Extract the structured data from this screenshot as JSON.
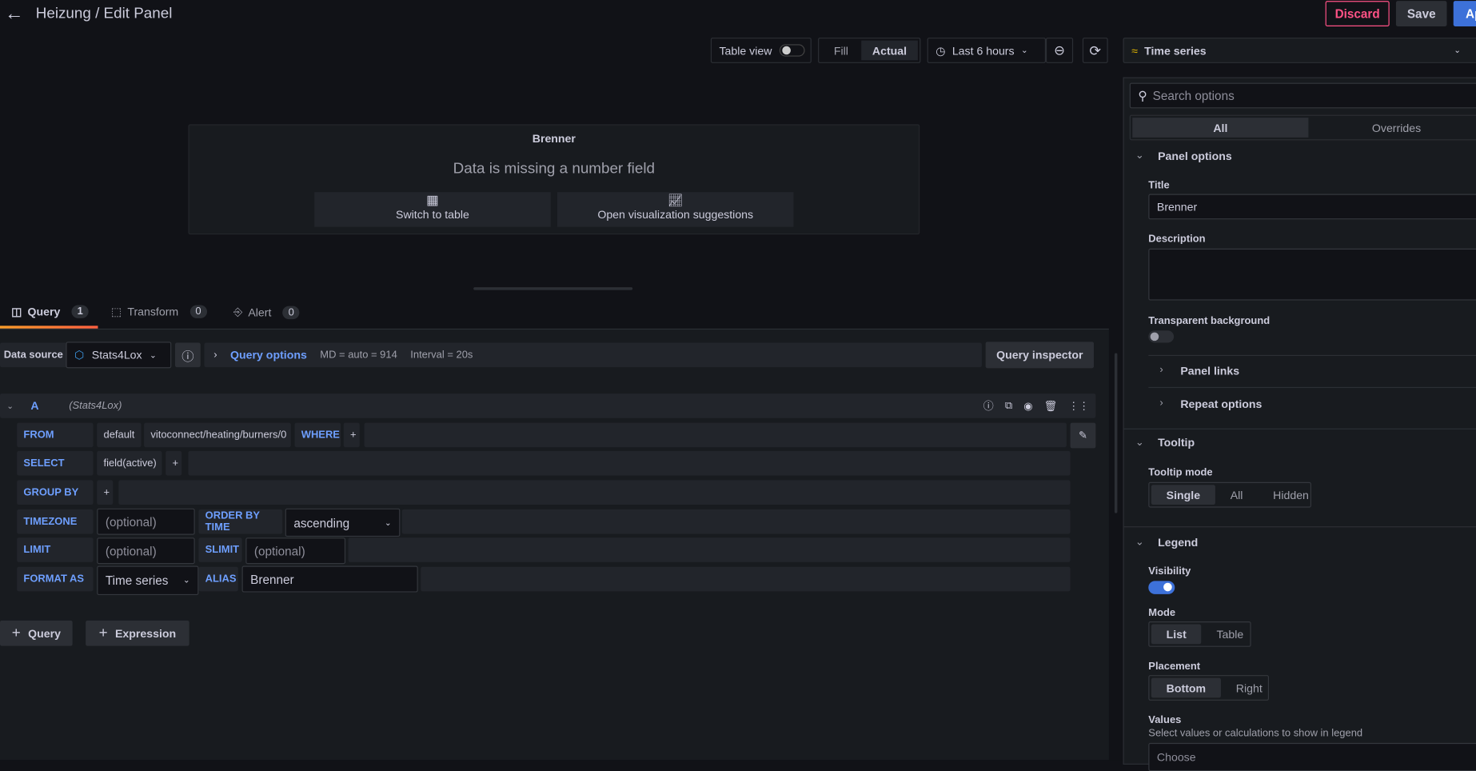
{
  "header": {
    "title": "Heizung / Edit Panel",
    "discard": "Discard",
    "save": "Save",
    "apply": "Apply"
  },
  "toolbar": {
    "table_view": "Table view",
    "fill": "Fill",
    "actual": "Actual",
    "time_range": "Last 6 hours"
  },
  "preview": {
    "title": "Brenner",
    "message": "Data is missing a number field",
    "switch_table": "Switch to table",
    "open_suggestions": "Open visualization suggestions"
  },
  "tabs": [
    {
      "label": "Query",
      "count": "1"
    },
    {
      "label": "Transform",
      "count": "0"
    },
    {
      "label": "Alert",
      "count": "0"
    }
  ],
  "datasource": {
    "label": "Data source",
    "value": "Stats4Lox",
    "query_options": "Query options",
    "md": "MD = auto = 914",
    "interval": "Interval = 20s",
    "inspector": "Query inspector"
  },
  "query": {
    "ref": "A",
    "source": "(Stats4Lox)",
    "from": {
      "label": "FROM",
      "policy": "default",
      "measurement": "vitoconnect/heating/burners/0",
      "where": "WHERE",
      "plus": "+"
    },
    "select": {
      "label": "SELECT",
      "field": "field(active)",
      "plus": "+"
    },
    "group_by": {
      "label": "GROUP BY",
      "plus": "+"
    },
    "timezone": {
      "label": "TIMEZONE",
      "placeholder": "(optional)",
      "order_label": "ORDER BY TIME",
      "order_value": "ascending"
    },
    "limit": {
      "label": "LIMIT",
      "placeholder": "(optional)",
      "slimit_label": "SLIMIT",
      "slimit_placeholder": "(optional)"
    },
    "format": {
      "label": "FORMAT AS",
      "value": "Time series",
      "alias_label": "ALIAS",
      "alias_value": "Brenner"
    }
  },
  "add": {
    "query": "Query",
    "expression": "Expression"
  },
  "options": {
    "viz": "Time series",
    "search_placeholder": "Search options",
    "tab_all": "All",
    "tab_overrides": "Overrides",
    "panel_options": "Panel options",
    "title_label": "Title",
    "title_value": "Brenner",
    "description_label": "Description",
    "transparent_label": "Transparent background",
    "transparent_on": false,
    "panel_links": "Panel links",
    "repeat_options": "Repeat options",
    "tooltip": "Tooltip",
    "tooltip_mode_label": "Tooltip mode",
    "tooltip_modes": [
      "Single",
      "All",
      "Hidden"
    ],
    "legend": "Legend",
    "visibility_label": "Visibility",
    "visibility_on": true,
    "mode_label": "Mode",
    "modes": [
      "List",
      "Table"
    ],
    "placement_label": "Placement",
    "placements": [
      "Bottom",
      "Right"
    ],
    "values_label": "Values",
    "values_desc": "Select values or calculations to show in legend",
    "values_placeholder": "Choose"
  },
  "colors": {
    "accent": "#3d71d9",
    "discard": "#ff5286",
    "label": "#6e9fff",
    "tab_underline": "#ff7941"
  }
}
